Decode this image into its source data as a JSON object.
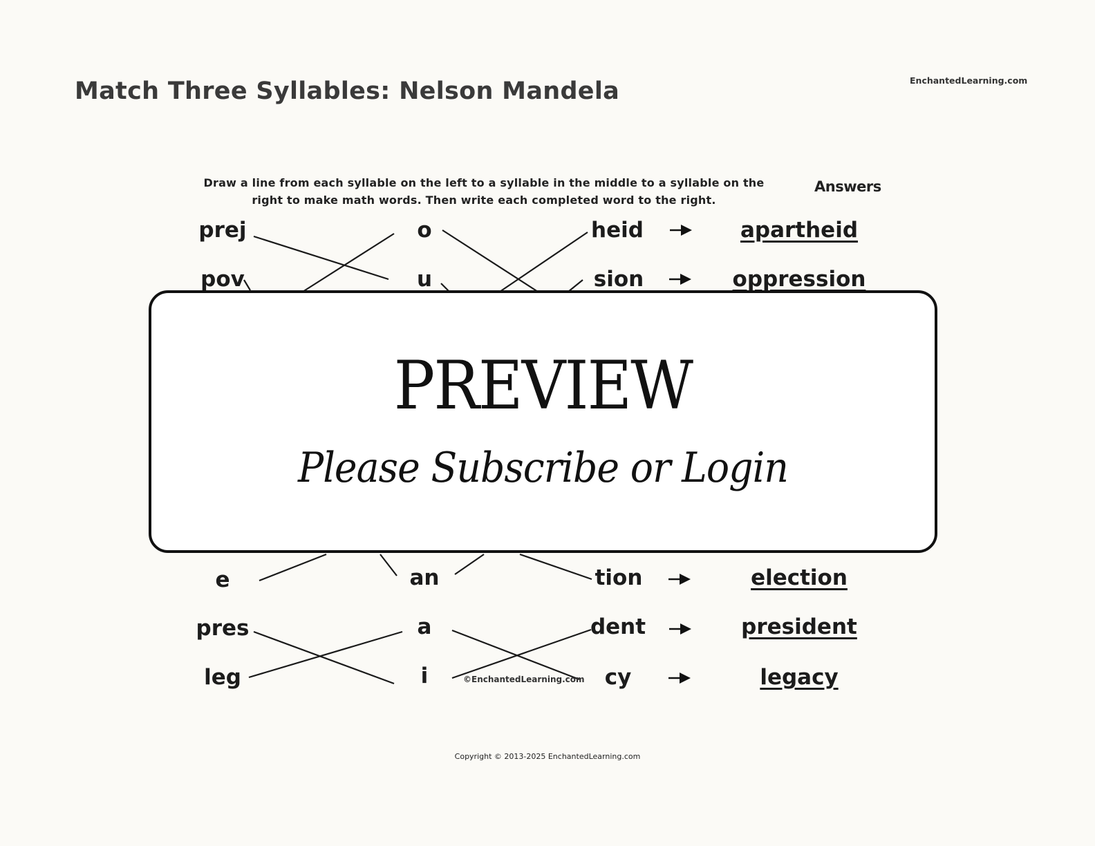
{
  "header": {
    "title": "Match Three Syllables: Nelson Mandela",
    "site": "EnchantedLearning.com"
  },
  "worksheet": {
    "instructions_line1": "Draw a line from each syllable on the left to a syllable in the middle to a syllable on the",
    "instructions_line2": "right to make math words.  Then write each completed word to the right.",
    "answers_label": "Answers",
    "left": [
      "prej",
      "pov",
      "e",
      "pres",
      "leg"
    ],
    "middle": [
      "o",
      "u",
      "an",
      "a",
      "i"
    ],
    "right": [
      "heid",
      "sion",
      "tion",
      "dent",
      "cy"
    ],
    "answers": [
      "apartheid",
      "oppression",
      "election",
      "president",
      "legacy"
    ],
    "arrow_icon": "right-arrow-icon",
    "inner_copyright": "©EnchantedLearning.com"
  },
  "overlay": {
    "heading": "PREVIEW",
    "subheading": "Please Subscribe or Login"
  },
  "footer": {
    "copyright": "Copyright © 2013-2025 EnchantedLearning.com"
  }
}
